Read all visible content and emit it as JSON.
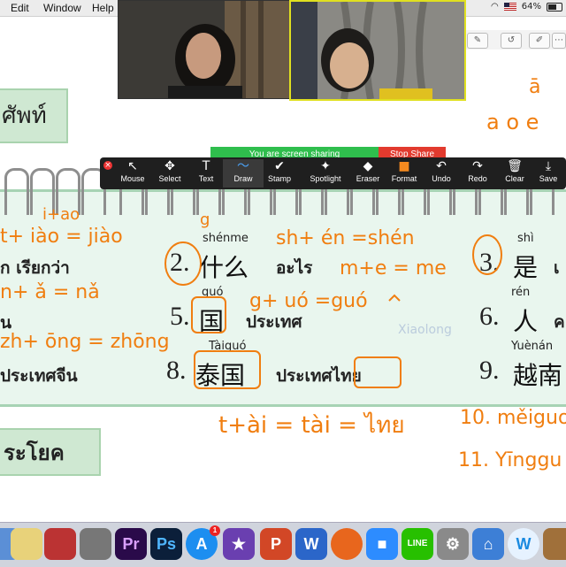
{
  "menubar": {
    "items": [
      "Edit",
      "Window",
      "Help"
    ],
    "battery": "64%"
  },
  "lesson": {
    "header_fragment": "ศัพท์",
    "section_fragment": "ระโยค",
    "rows": [
      {
        "fragment_left": "ก เรียกว่า",
        "num2": "2.",
        "pinyin2": "shénme",
        "hanzi2": "什么",
        "thai2": "อะไร",
        "num3": "3.",
        "pinyin3": "shì",
        "hanzi3": "是",
        "thai3": "เ"
      },
      {
        "fragment_left": "น",
        "num2": "5.",
        "pinyin2": "guó",
        "hanzi2": "国",
        "thai2": "ประเทศ",
        "num3": "6.",
        "pinyin3": "rén",
        "hanzi3": "人",
        "thai3": "ค"
      },
      {
        "fragment_left": "ประเทศจีน",
        "num2": "8.",
        "pinyin2": "Tàiguó",
        "hanzi2": "泰国",
        "thai2": "ประเทศไทย",
        "num3": "9.",
        "pinyin3": "Yuènán",
        "hanzi3": "越南",
        "thai3": ""
      }
    ],
    "faint_label": "Xiaolong"
  },
  "handwriting": {
    "top_a": "ā",
    "aoe": "a o e",
    "g": "g",
    "i_ao": "i+ao",
    "t_iao": "t+ iào = jiào",
    "sh_en": "sh+ én =shén",
    "m_e": "m+e = me",
    "n_a": "n+ ǎ = nǎ",
    "g_uo": "g+ uó =guó",
    "zh_ong": "zh+ ōng = zhōng",
    "t_ai": "t+ài = tài = ไทย",
    "meiguo": "10. měiguo",
    "yingguo": "11. Yīnggu"
  },
  "share": {
    "status": "You are screen sharing",
    "stop": "Stop Share"
  },
  "annotate": {
    "tools": [
      {
        "label": "Mouse",
        "icon": "cursor-icon",
        "glyph": "↖"
      },
      {
        "label": "Select",
        "icon": "move-icon",
        "glyph": "✥"
      },
      {
        "label": "Text",
        "icon": "text-icon",
        "glyph": "T"
      },
      {
        "label": "Draw",
        "icon": "draw-icon",
        "glyph": "〜"
      },
      {
        "label": "Stamp",
        "icon": "check-icon",
        "glyph": "✔"
      },
      {
        "label": "Spotlight",
        "icon": "spotlight-icon",
        "glyph": "✦"
      },
      {
        "label": "Eraser",
        "icon": "eraser-icon",
        "glyph": "◆"
      },
      {
        "label": "Format",
        "icon": "format-swatch-icon",
        "glyph": "■"
      },
      {
        "label": "Undo",
        "icon": "undo-icon",
        "glyph": "↶"
      },
      {
        "label": "Redo",
        "icon": "redo-icon",
        "glyph": "↷"
      },
      {
        "label": "Clear",
        "icon": "trash-icon",
        "glyph": "🗑"
      },
      {
        "label": "Save",
        "icon": "save-icon",
        "glyph": "⤓"
      }
    ],
    "selected": "Draw",
    "format_color": "#f58a1f"
  },
  "dock": {
    "apps": [
      {
        "name": "finder-icon",
        "label": "",
        "color": "#5b8fd6"
      },
      {
        "name": "notes-icon",
        "label": "",
        "color": "#e8d27a"
      },
      {
        "name": "photo-booth-icon",
        "label": "",
        "color": "#b33"
      },
      {
        "name": "image-capture-icon",
        "label": "",
        "color": "#777"
      },
      {
        "name": "premiere-icon",
        "label": "Pr",
        "color": "#2a0a4a"
      },
      {
        "name": "photoshop-icon",
        "label": "Ps",
        "color": "#0b1f3a"
      },
      {
        "name": "app-store-icon",
        "label": "A",
        "color": "#1c8ef0",
        "badge": "1"
      },
      {
        "name": "imovie-icon",
        "label": "★",
        "color": "#6a3fb0"
      },
      {
        "name": "powerpoint-icon",
        "label": "P",
        "color": "#d24726"
      },
      {
        "name": "word-icon",
        "label": "W",
        "color": "#2b66c9"
      },
      {
        "name": "firefox-icon",
        "label": "",
        "color": "#e8661d"
      },
      {
        "name": "zoom-icon",
        "label": "",
        "color": "#2d8cff"
      },
      {
        "name": "line-icon",
        "label": "LINE",
        "color": "#27c000"
      },
      {
        "name": "system-prefs-icon",
        "label": "⚙",
        "color": "#8a8a8a"
      },
      {
        "name": "network-icon",
        "label": "⌂",
        "color": "#3d7fd6"
      },
      {
        "name": "w-app-icon",
        "label": "W",
        "color": "#e6f2ff"
      },
      {
        "name": "photo-stack-icon",
        "label": "",
        "color": "#a0703a"
      }
    ]
  }
}
